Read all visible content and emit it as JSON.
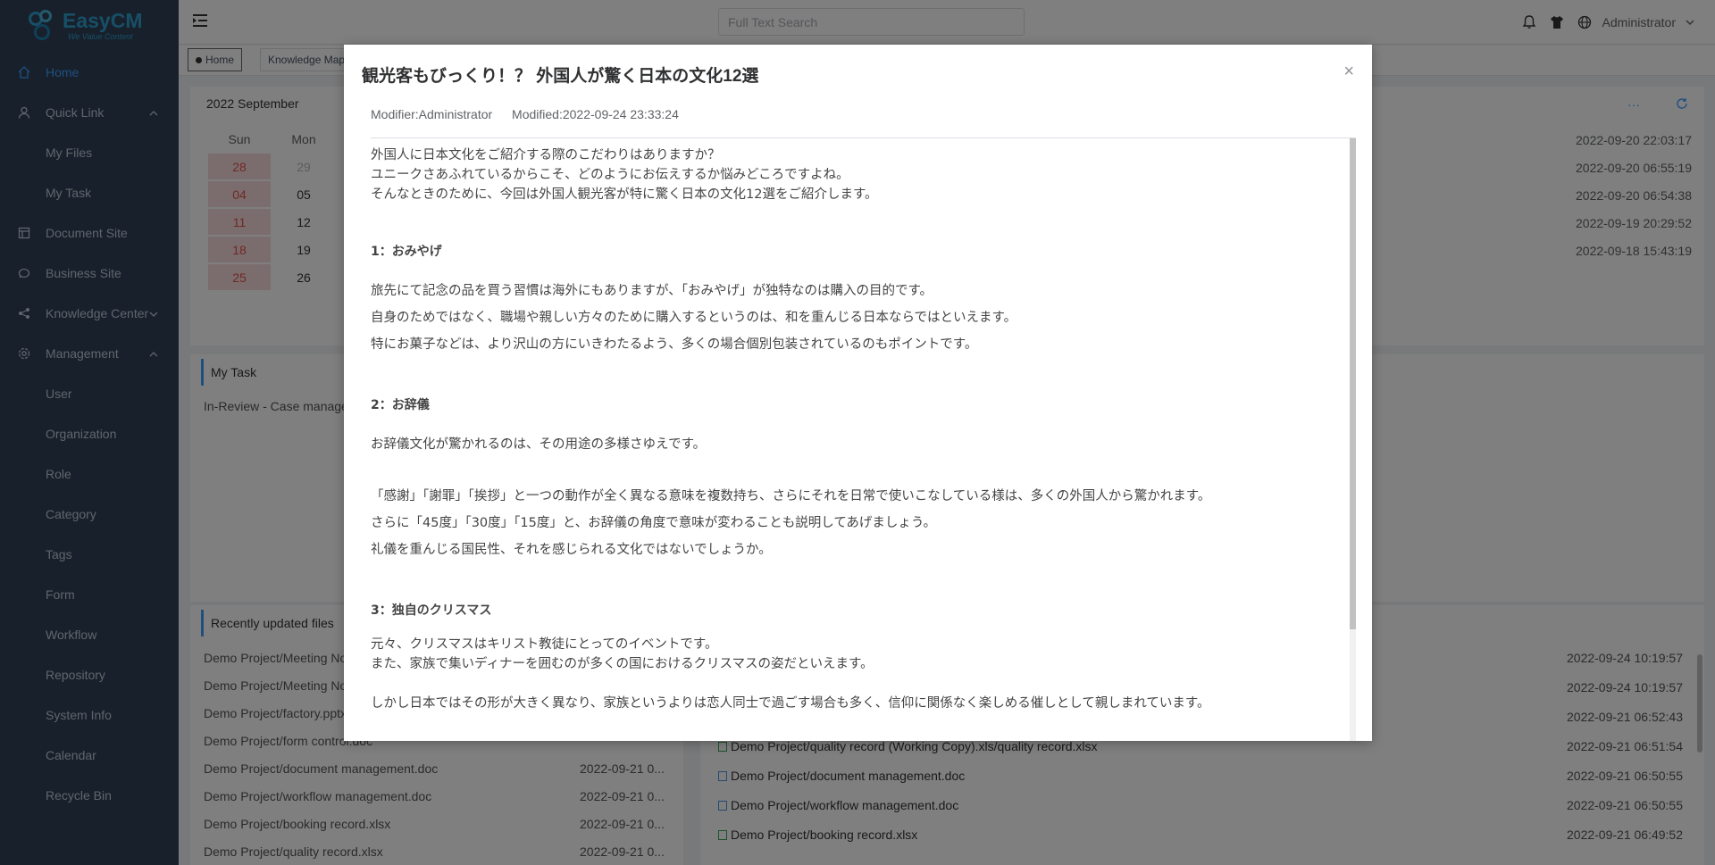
{
  "app": {
    "name": "EasyCM",
    "slogan": "We Value Content"
  },
  "sidebar": {
    "items": [
      {
        "label": "Home",
        "icon": "home-icon",
        "active": true,
        "sub": false
      },
      {
        "label": "Quick Link",
        "icon": "user-icon",
        "sub": false,
        "arrow": "up"
      },
      {
        "label": "My Files",
        "sub": true
      },
      {
        "label": "My Task",
        "sub": true
      },
      {
        "label": "Document Site",
        "icon": "document-site-icon",
        "sub": false
      },
      {
        "label": "Business Site",
        "icon": "business-site-icon",
        "sub": false
      },
      {
        "label": "Knowledge Center",
        "icon": "share-icon",
        "sub": false,
        "arrow": "down"
      },
      {
        "label": "Management",
        "icon": "gear-icon",
        "sub": false,
        "arrow": "up"
      },
      {
        "label": "User",
        "sub": true
      },
      {
        "label": "Organization",
        "sub": true
      },
      {
        "label": "Role",
        "sub": true
      },
      {
        "label": "Category",
        "sub": true
      },
      {
        "label": "Tags",
        "sub": true
      },
      {
        "label": "Form",
        "sub": true
      },
      {
        "label": "Workflow",
        "sub": true
      },
      {
        "label": "Repository",
        "sub": true
      },
      {
        "label": "System Info",
        "sub": true
      },
      {
        "label": "Calendar",
        "sub": true
      },
      {
        "label": "Recycle Bin",
        "sub": true
      }
    ]
  },
  "topbar": {
    "search_placeholder": "Full Text Search",
    "user": "Administrator"
  },
  "tags": {
    "home": "Home",
    "knowledge": "Knowledge Map"
  },
  "calendar": {
    "title": "2022 September",
    "headers": [
      "Sun",
      "Mon"
    ],
    "rows": [
      [
        "28",
        "29"
      ],
      [
        "04",
        "05"
      ],
      [
        "11",
        "12"
      ],
      [
        "18",
        "19"
      ],
      [
        "25",
        "26"
      ]
    ]
  },
  "log": {
    "times": [
      "2022-09-20 22:03:17",
      "2022-09-20 06:55:19",
      "2022-09-20 06:54:38",
      "2022-09-19 20:29:52",
      "2022-09-18 15:43:19"
    ]
  },
  "my_task": {
    "title": "My Task",
    "item": "In-Review - Case management"
  },
  "recent": {
    "title": "Recently updated files",
    "files": [
      {
        "name": "Demo Project/Meeting Notes",
        "date": ""
      },
      {
        "name": "Demo Project/Meeting Notes",
        "date": ""
      },
      {
        "name": "Demo Project/factory.pptx",
        "date": ""
      },
      {
        "name": "Demo Project/form control.doc",
        "date": ""
      },
      {
        "name": "Demo Project/document management.doc",
        "date": "2022-09-21 0..."
      },
      {
        "name": "Demo Project/workflow management.doc",
        "date": "2022-09-21 0..."
      },
      {
        "name": "Demo Project/booking record.xlsx",
        "date": "2022-09-21 0..."
      },
      {
        "name": "Demo Project/quality record.xlsx",
        "date": "2022-09-21 0..."
      }
    ]
  },
  "modified": {
    "rows": [
      {
        "name": "",
        "date": "2022-09-24 10:19:57",
        "type": "doc"
      },
      {
        "name": "",
        "date": "2022-09-24 10:19:57",
        "type": "doc"
      },
      {
        "name": "",
        "date": "2022-09-21 06:52:43",
        "type": "doc"
      },
      {
        "name": "Demo Project/quality record (Working Copy).xls/quality record.xlsx",
        "date": "2022-09-21 06:51:54",
        "type": "xls"
      },
      {
        "name": "Demo Project/document management.doc",
        "date": "2022-09-21 06:50:55",
        "type": "doc"
      },
      {
        "name": "Demo Project/workflow management.doc",
        "date": "2022-09-21 06:50:55",
        "type": "doc"
      },
      {
        "name": "Demo Project/booking record.xlsx",
        "date": "2022-09-21 06:49:52",
        "type": "xls"
      }
    ]
  },
  "modal": {
    "title": "観光客もびっくり！？ 外国人が驚く日本の文化12選",
    "modifier": "Modifier:Administrator",
    "modified": "Modified:2022-09-24 23:33:24",
    "close": "×",
    "intro": [
      "外国人に日本文化をご紹介する際のこだわりはありますか？",
      "ユニークさあふれているからこそ、どのようにお伝えするか悩みどころですよね。",
      "そんなときのために、今回は外国人観光客が特に驚く日本の文化12選をご紹介します。"
    ],
    "s1_title": "1：おみやげ",
    "s1": [
      "旅先にて記念の品を買う習慣は海外にもありますが、「おみやげ」が独特なのは購入の目的です。",
      "自身のためではなく、職場や親しい方々のために購入するというのは、和を重んじる日本ならではといえます。",
      "特にお菓子などは、より沢山の方にいきわたるよう、多くの場合個別包装されているのもポイントです。"
    ],
    "s2_title": "2：お辞儀",
    "s2a": "お辞儀文化が驚かれるのは、その用途の多様さゆえです。",
    "s2": [
      "「感謝」「謝罪」「挨拶」と一つの動作が全く異なる意味を複数持ち、さらにそれを日常で使いこなしている様は、多くの外国人から驚かれます。",
      "さらに「45度」「30度」「15度」と、お辞儀の角度で意味が変わることも説明してあげましょう。",
      "礼儀を重んじる国民性、それを感じられる文化ではないでしょうか。"
    ],
    "s3_title": "3：独自のクリスマス",
    "s3": [
      "元々、クリスマスはキリスト教徒にとってのイベントです。",
      "また、家族で集いディナーを囲むのが多くの国におけるクリスマスの姿だといえます。"
    ],
    "s3b": "しかし日本ではその形が大きく異なり、家族というよりは恋人同士で過ごす場合も多く、信仰に関係なく楽しめる催しとして親しまれています。"
  }
}
